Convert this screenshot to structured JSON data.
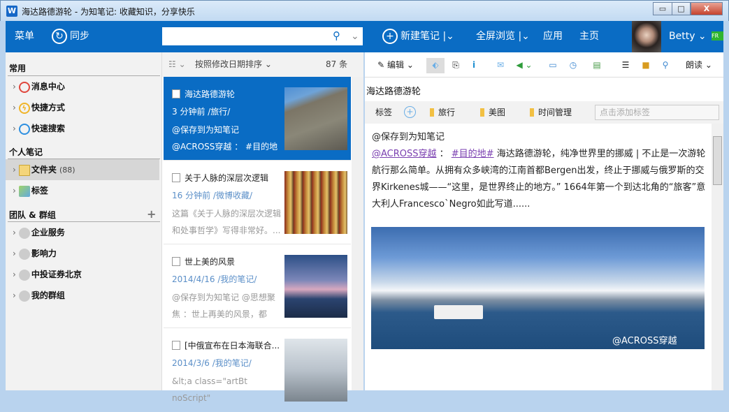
{
  "window": {
    "title": "海达路德游轮 - 为知笔记: 收藏知识，分享快乐",
    "app_icon": "W",
    "min": "▭",
    "max": "□",
    "close": "X"
  },
  "topbar": {
    "menu": "菜单",
    "sync": "同步",
    "search_placeholder": "",
    "new_note": "新建笔记",
    "fullscreen": "全屏浏览",
    "apps": "应用",
    "home": "主页",
    "user": "Betty",
    "badge": "FR"
  },
  "sidebar": {
    "sections": [
      {
        "title": "常用",
        "items": [
          {
            "label": "消息中心",
            "icon": "message-icon"
          },
          {
            "label": "快捷方式",
            "icon": "shortcut-icon"
          },
          {
            "label": "快速搜索",
            "icon": "quick-search-icon"
          }
        ]
      },
      {
        "title": "个人笔记",
        "items": [
          {
            "label": "文件夹",
            "count": "(88)",
            "icon": "folder-icon"
          },
          {
            "label": "标签",
            "icon": "tag-icon"
          }
        ]
      },
      {
        "title": "团队 & 群组",
        "items": [
          {
            "label": "企业服务"
          },
          {
            "label": "影响力"
          },
          {
            "label": "中投证券北京"
          },
          {
            "label": "我的群组"
          }
        ]
      }
    ]
  },
  "list": {
    "sort": "按照修改日期排序",
    "count": "87 条",
    "notes": [
      {
        "title": "海达路德游轮",
        "meta": "3 分钟前   /旅行/",
        "snippet": " @保存到为知笔记 @ACROSS穿越 ： #目的地# 海达路..."
      },
      {
        "title": "关于人脉的深层次逻辑",
        "meta": "16 分钟前   /微博收藏/",
        "snippet": "这篇《关于人脉的深层次逻辑和处事哲学》写得非常好。..."
      },
      {
        "title": "世上美的风景",
        "meta": "2014/4/16   /我的笔记/",
        "snippet": " @保存到为知笔记 @思想聚焦 ：世上再美的风景，都不..."
      },
      {
        "title": "[中俄宣布在日本海联合...",
        "meta": "2014/3/6   /我的笔记/",
        "snippet": "&lt;a class=\"artBt noScript\""
      }
    ]
  },
  "editor": {
    "edit": "编辑",
    "read": "朗读",
    "title": "海达路德游轮",
    "tags_label": "标签",
    "tags": [
      "旅行",
      "美图",
      "时间管理"
    ],
    "tag_placeholder": "点击添加标签",
    "content": {
      "line1": "@保存到为知笔记",
      "mention": "@ACROSS穿越",
      "colon": " ： ",
      "hashtag": "#目的地#",
      "body": " 海达路德游轮，纯净世界里的挪威 | 不止是一次游轮航行那么简单。从拥有众多峡湾的江南首都Bergen出发，终止于挪威与俄罗斯的交界Kirkenes城——“这里，是世界终止的地方。” 1664年第一个到达北角的“旅客”意大利人Francesco`Negro如此写道......"
    },
    "photo_watermark": "@ACROSS穿越"
  }
}
